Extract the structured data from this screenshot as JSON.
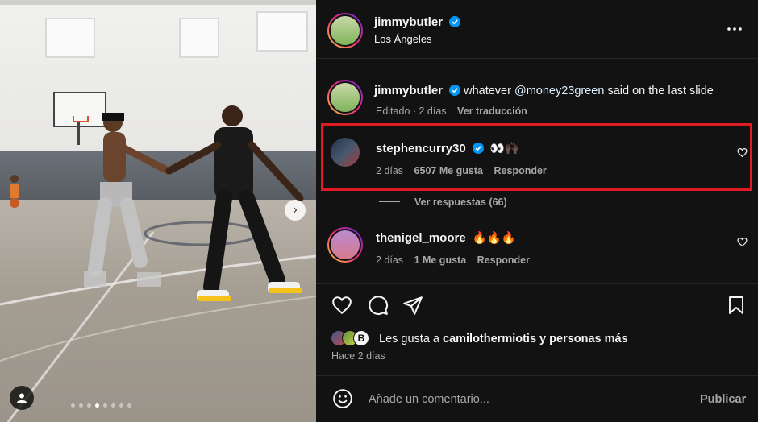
{
  "post": {
    "author": "jimmybutler",
    "location": "Los Ángeles",
    "more_icon": "more-horizontal-icon"
  },
  "caption": {
    "username": "jimmybutler",
    "text_before": "whatever ",
    "mention": "@money23green",
    "text_after": " said on the last slide",
    "edited": "Editado · 2 días",
    "translate": "Ver traducción"
  },
  "comments": [
    {
      "username": "stephencurry30",
      "verified": true,
      "text": "👀🙌🏿",
      "time": "2 días",
      "likes": "6507 Me gusta",
      "reply": "Responder",
      "view_replies": "Ver respuestas (66)"
    },
    {
      "username": "thenigel_moore",
      "verified": false,
      "text": "🔥🔥🔥",
      "time": "2 días",
      "likes": "1 Me gusta",
      "reply": "Responder"
    }
  ],
  "likes": {
    "prefix": "Les gusta a ",
    "user": "camilothermiotis",
    "suffix": " y personas más"
  },
  "posted": "Hace 2 días",
  "comment_input": {
    "placeholder": "Añade un comentario...",
    "publish": "Publicar"
  },
  "colors": {
    "highlight": "#e01b23",
    "verified": "#0095f6",
    "mention": "#e0f1ff"
  }
}
